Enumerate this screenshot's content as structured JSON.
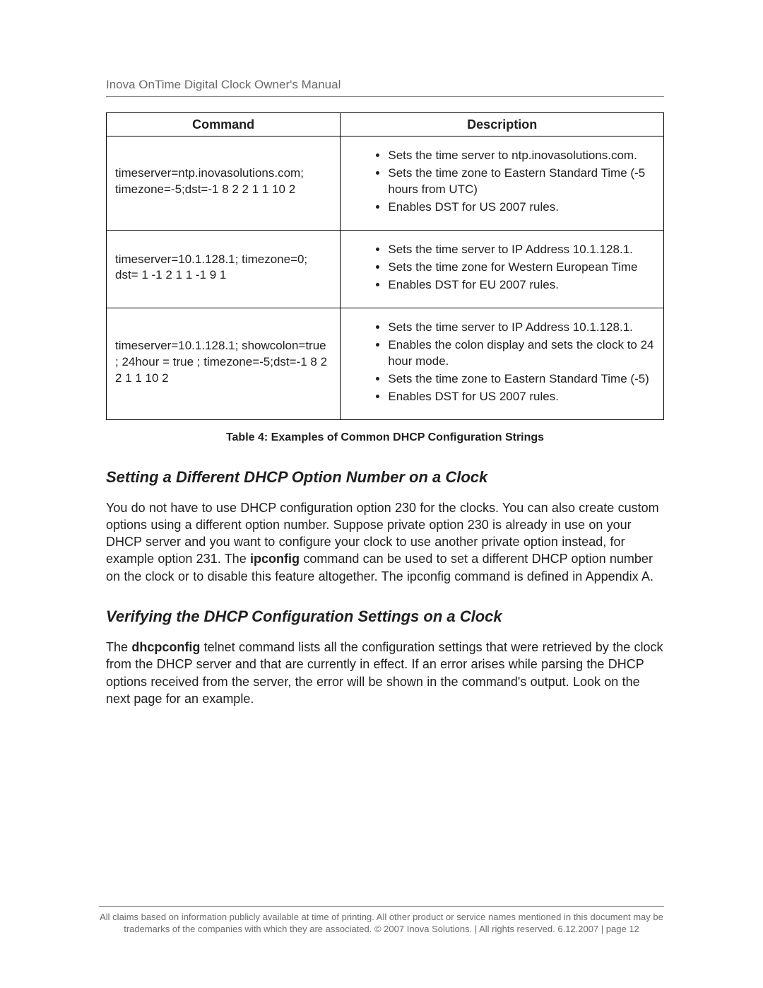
{
  "header": {
    "title": "Inova OnTime Digital Clock Owner's Manual"
  },
  "table": {
    "headers": {
      "command": "Command",
      "description": "Description"
    },
    "rows": [
      {
        "command": "timeserver=ntp.inovasolutions.com; timezone=-5;dst=-1 8 2 2 1 1 10 2",
        "bullets": [
          "Sets the time server to ntp.inovasolutions.com.",
          "Sets the time zone to Eastern Standard Time (-5 hours from UTC)",
          "Enables DST for US 2007 rules."
        ]
      },
      {
        "command": "timeserver=10.1.128.1; timezone=0; dst= 1 -1 2 1 1 -1 9 1",
        "bullets": [
          "Sets the time server to IP Address 10.1.128.1.",
          "Sets the time zone for Western European Time",
          "Enables DST for EU 2007 rules."
        ]
      },
      {
        "command": "timeserver=10.1.128.1; showcolon=true ; 24hour = true ; timezone=-5;dst=-1 8 2 2 1 1 10 2",
        "bullets": [
          "Sets the time server to IP Address 10.1.128.1.",
          "Enables the colon display and sets the clock to 24 hour mode.",
          "Sets the time zone to Eastern Standard Time (-5)",
          "Enables DST for US 2007 rules."
        ]
      }
    ],
    "caption": "Table 4:  Examples of Common DHCP Configuration Strings"
  },
  "sections": [
    {
      "heading": "Setting a Different DHCP Option Number on a Clock",
      "para_pre": "You do not have to use DHCP configuration option 230 for the clocks.  You can also create custom options using a different option number.  Suppose private option 230 is already in use on your DHCP server and you want to configure your clock to use another private option instead, for example option 231. The ",
      "para_bold": "ipconfig",
      "para_post": " command can be used to set a different DHCP option number on the clock or to disable this feature altogether.    The ipconfig command is defined in Appendix A."
    },
    {
      "heading": "Verifying the DHCP Configuration Settings on a Clock",
      "para_pre": "The ",
      "para_bold": "dhcpconfig",
      "para_post": " telnet command lists all the configuration settings that were retrieved by the clock from the DHCP server and that are currently in effect.  If an error arises while parsing the DHCP options received from the server,  the error will be shown in the command's output.   Look on the next page for an example."
    }
  ],
  "footer": {
    "line1": "All claims based on information publicly available at time of printing. All other product or service names mentioned in this document may be",
    "line2": "trademarks of the companies with which they are associated. © 2007 Inova Solutions.  |  All rights reserved. 6.12.2007  |  page 12"
  }
}
